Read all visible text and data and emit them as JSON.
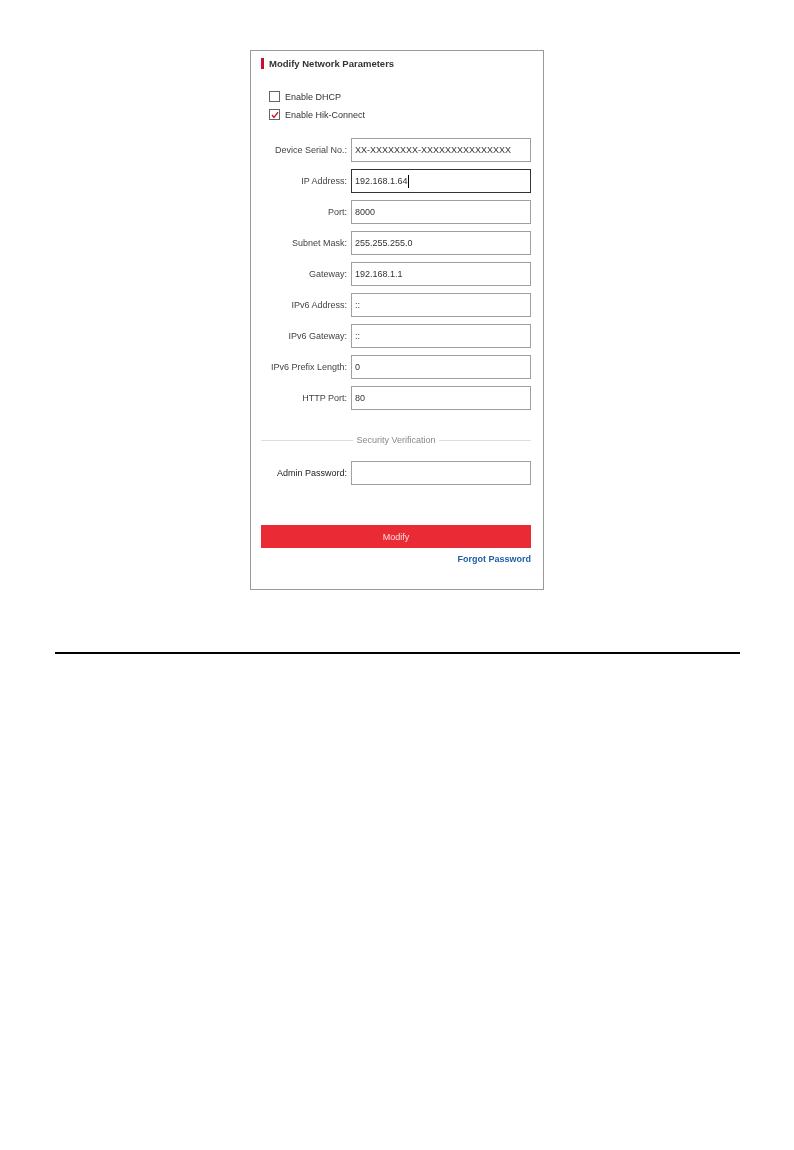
{
  "panel": {
    "title": "Modify Network Parameters",
    "checkboxes": [
      {
        "label": "Enable DHCP",
        "checked": false
      },
      {
        "label": "Enable Hik-Connect",
        "checked": true
      }
    ],
    "fields": [
      {
        "label": "Device Serial No.:",
        "value": "XX-XXXXXXXX-XXXXXXXXXXXXXXX",
        "focused": false
      },
      {
        "label": "IP Address:",
        "value": "192.168.1.64",
        "focused": true
      },
      {
        "label": "Port:",
        "value": "8000",
        "focused": false
      },
      {
        "label": "Subnet Mask:",
        "value": "255.255.255.0",
        "focused": false
      },
      {
        "label": "Gateway:",
        "value": "192.168.1.1",
        "focused": false
      },
      {
        "label": "IPv6 Address:",
        "value": "::",
        "focused": false
      },
      {
        "label": "IPv6 Gateway:",
        "value": "::",
        "focused": false
      },
      {
        "label": "IPv6 Prefix Length:",
        "value": "0",
        "focused": false
      },
      {
        "label": "HTTP Port:",
        "value": "80",
        "focused": false
      }
    ],
    "section_title": "Security Verification",
    "password": {
      "label": "Admin Password:"
    },
    "submit_button": "Modify",
    "forgot_link": "Forgot Password"
  }
}
